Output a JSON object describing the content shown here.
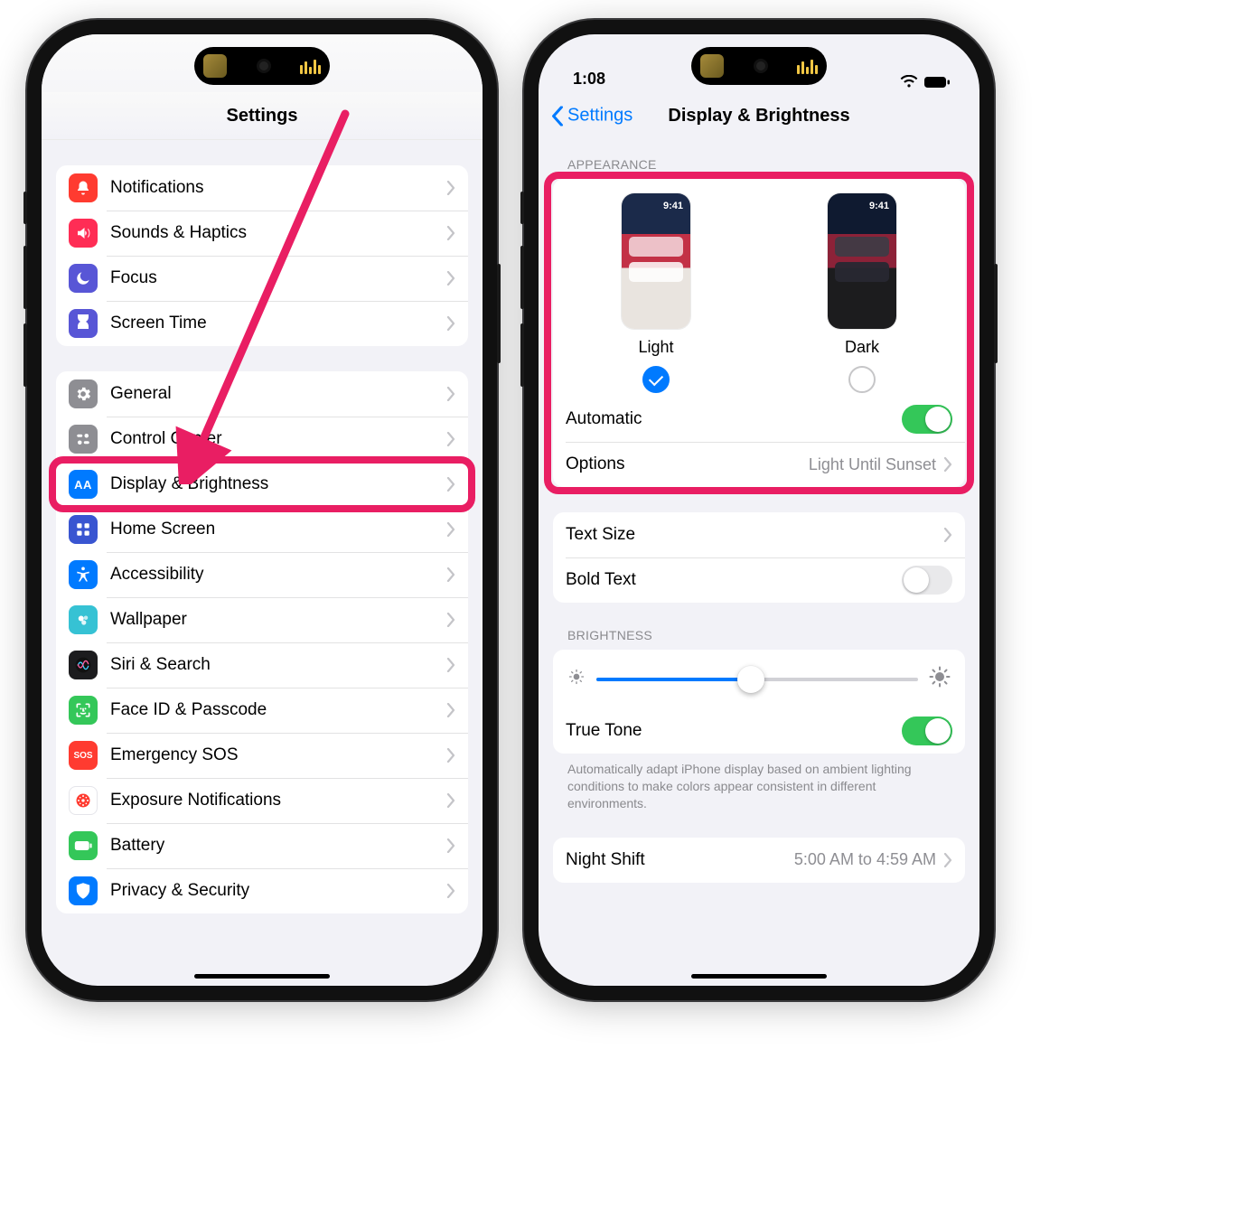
{
  "status": {
    "time": "1:08"
  },
  "left": {
    "title": "Settings",
    "group1": [
      {
        "key": "notifications",
        "label": "Notifications",
        "bg": "#ff3b30"
      },
      {
        "key": "sounds",
        "label": "Sounds & Haptics",
        "bg": "#ff2d55"
      },
      {
        "key": "focus",
        "label": "Focus",
        "bg": "#5856d6"
      },
      {
        "key": "screentime",
        "label": "Screen Time",
        "bg": "#5856d6"
      }
    ],
    "group2": [
      {
        "key": "general",
        "label": "General",
        "bg": "#8e8e93"
      },
      {
        "key": "controlcenter",
        "label": "Control Center",
        "bg": "#8e8e93"
      },
      {
        "key": "display",
        "label": "Display & Brightness",
        "bg": "#007aff"
      },
      {
        "key": "homescreen",
        "label": "Home Screen",
        "bg": "#3955d1"
      },
      {
        "key": "accessibility",
        "label": "Accessibility",
        "bg": "#007aff"
      },
      {
        "key": "wallpaper",
        "label": "Wallpaper",
        "bg": "#36c2d4"
      },
      {
        "key": "siri",
        "label": "Siri & Search",
        "bg": "#1c1c1e"
      },
      {
        "key": "faceid",
        "label": "Face ID & Passcode",
        "bg": "#34c759"
      },
      {
        "key": "sos",
        "label": "Emergency SOS",
        "bg": "#ff3b30",
        "textIcon": "SOS"
      },
      {
        "key": "exposure",
        "label": "Exposure Notifications",
        "bg": "#ffffff"
      },
      {
        "key": "battery",
        "label": "Battery",
        "bg": "#34c759"
      },
      {
        "key": "privacy",
        "label": "Privacy & Security",
        "bg": "#007aff"
      }
    ]
  },
  "right": {
    "back": "Settings",
    "title": "Display & Brightness",
    "appearance_header": "APPEARANCE",
    "previews": {
      "light": {
        "label": "Light",
        "time": "9:41",
        "selected": true
      },
      "dark": {
        "label": "Dark",
        "time": "9:41",
        "selected": false
      }
    },
    "automatic": {
      "label": "Automatic",
      "on": true
    },
    "options": {
      "label": "Options",
      "value": "Light Until Sunset"
    },
    "text_size": {
      "label": "Text Size"
    },
    "bold_text": {
      "label": "Bold Text",
      "on": false
    },
    "brightness_header": "BRIGHTNESS",
    "brightness_pct": 48,
    "true_tone": {
      "label": "True Tone",
      "on": true
    },
    "true_tone_note": "Automatically adapt iPhone display based on ambient lighting conditions to make colors appear consistent in different environments.",
    "night_shift": {
      "label": "Night Shift",
      "value": "5:00 AM to 4:59 AM"
    }
  }
}
